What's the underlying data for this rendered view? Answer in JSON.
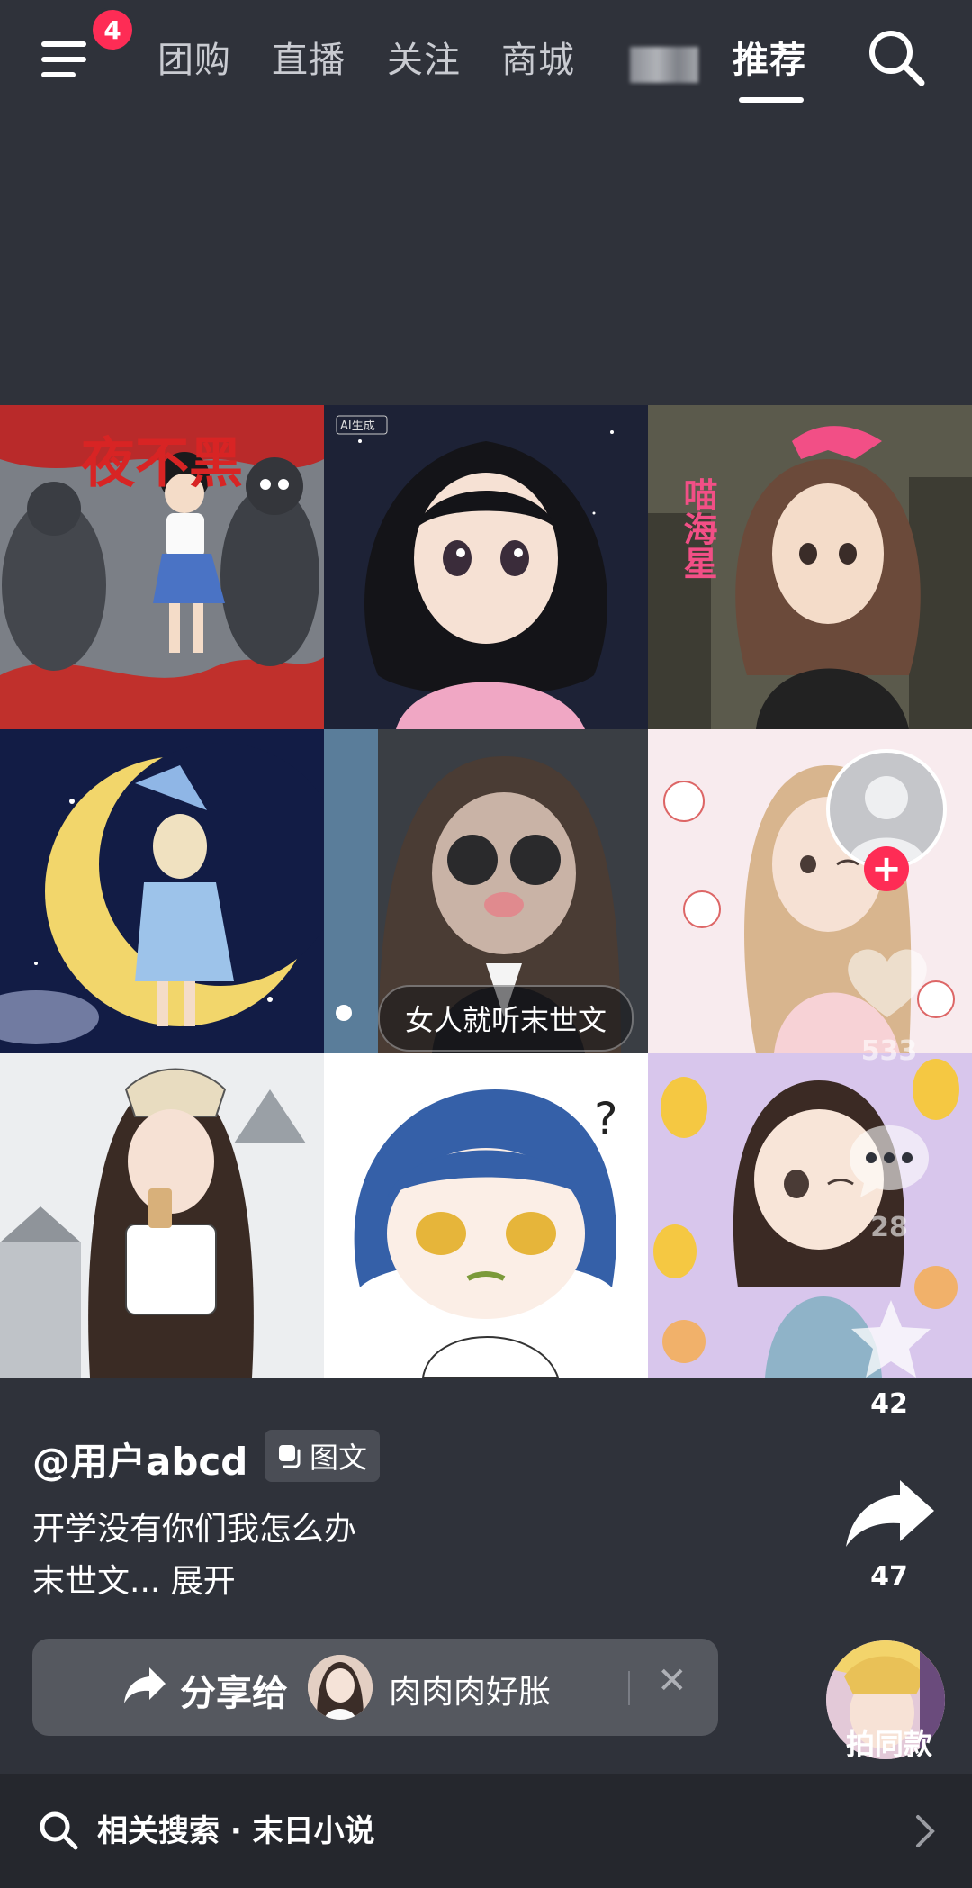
{
  "nav": {
    "notification_count": "4",
    "tabs": [
      {
        "label": "团购"
      },
      {
        "label": "直播"
      },
      {
        "label": "关注"
      },
      {
        "label": "商城"
      },
      {
        "label": "推荐"
      }
    ],
    "active_tab": "推荐",
    "icons": {
      "menu": "menu-icon",
      "search": "search-icon"
    }
  },
  "grid": {
    "cells": [
      {
        "overlay_text": "夜不黑"
      },
      {
        "overlay_text": "AI生成"
      },
      {
        "overlay_text": "喵海星"
      },
      {
        "overlay_text": ""
      },
      {
        "overlay_text": ""
      },
      {
        "overlay_text": ""
      },
      {
        "overlay_text": ""
      },
      {
        "overlay_text": "?"
      },
      {
        "overlay_text": ""
      }
    ],
    "caption_pill": "女人就听末世文"
  },
  "rail": {
    "like_count": "533",
    "comment_count": "28",
    "favorite_count": "42",
    "share_count": "47"
  },
  "post": {
    "username": "@用户abcd",
    "type_chip": "图文",
    "desc_line1": "开学没有你们我怎么办",
    "desc_line2": "末世文... 展开"
  },
  "share_bar": {
    "label": "分享给",
    "friend_name": "肉肉肉好胀",
    "close": "✕"
  },
  "music": {
    "label": "拍同款"
  },
  "related_search": {
    "text": "相关搜索 · 末日小说"
  },
  "colors": {
    "accent": "#fe2c55",
    "background": "#2f323a"
  }
}
